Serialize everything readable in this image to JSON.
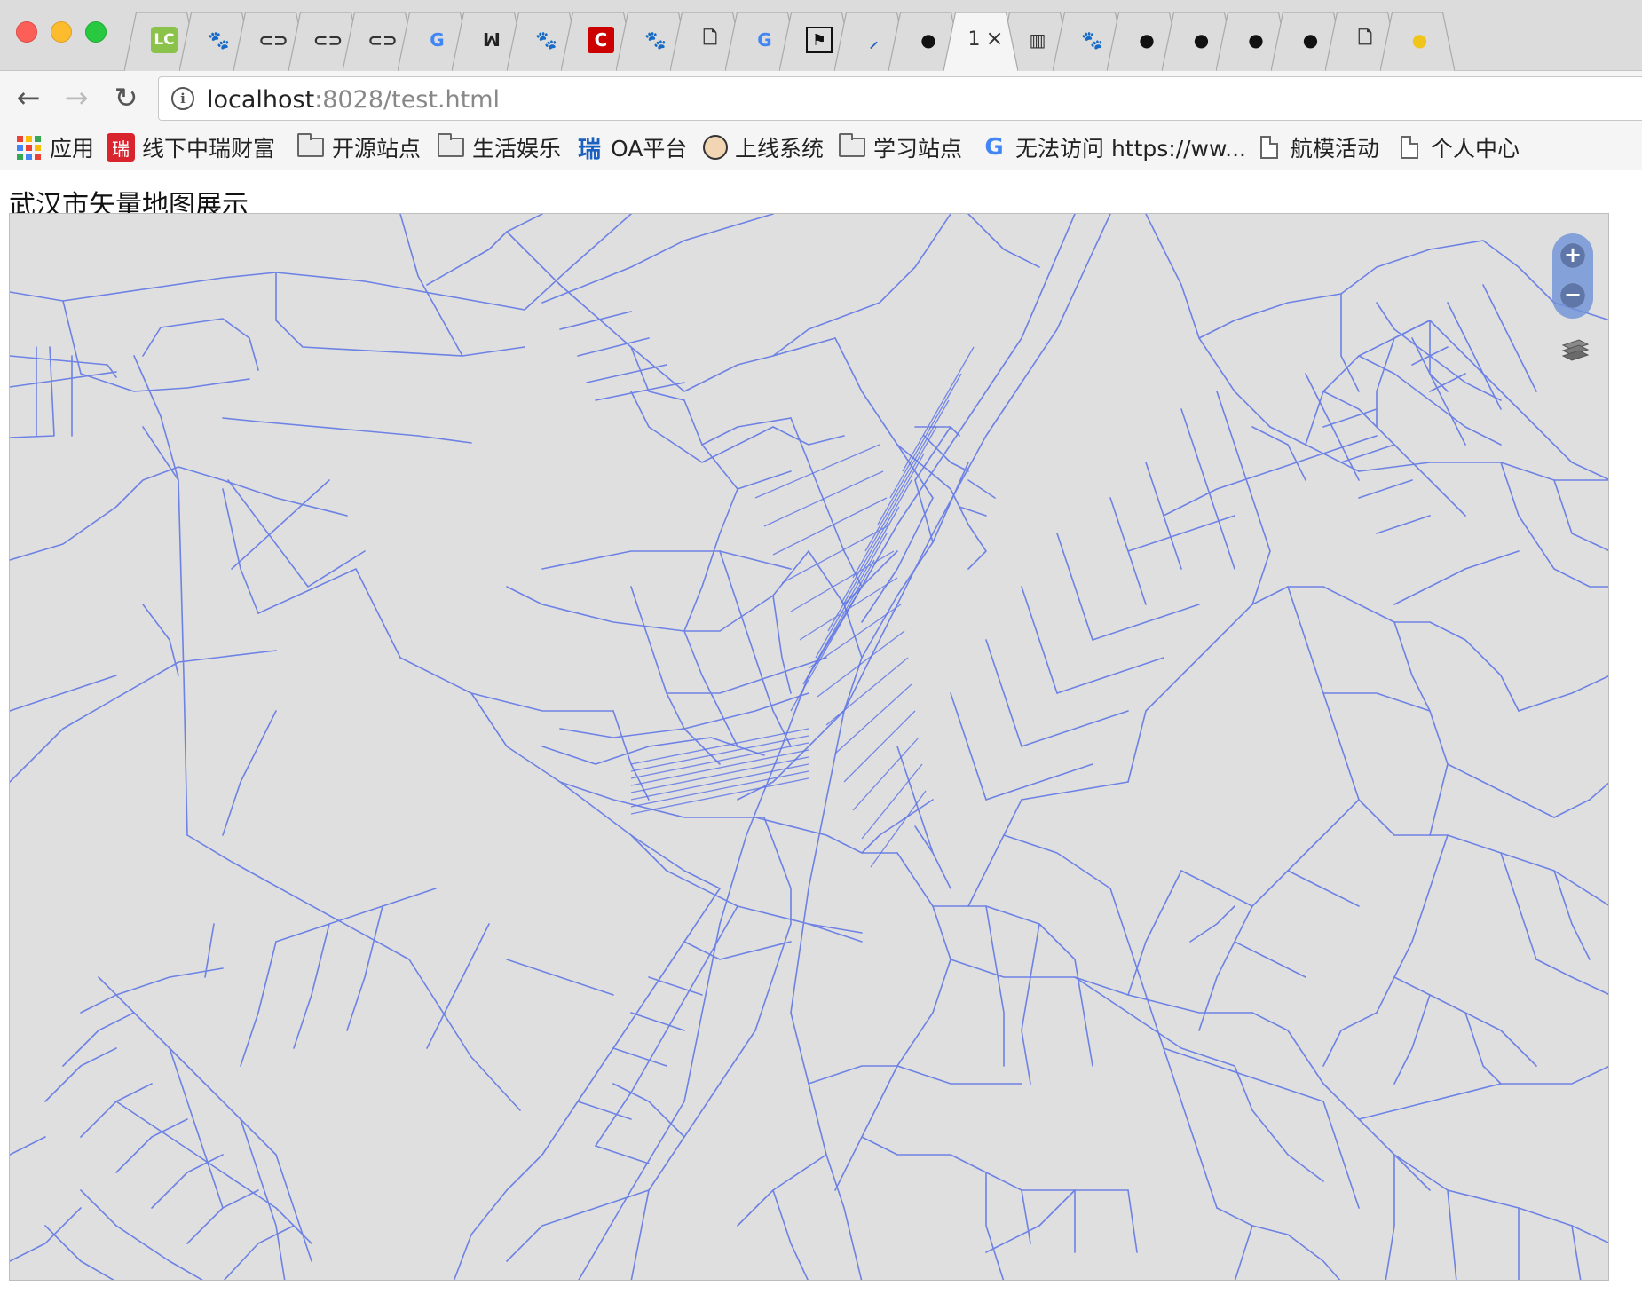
{
  "window": {
    "controls": [
      "close",
      "minimize",
      "zoom"
    ]
  },
  "tabs": [
    {
      "icon": "leetcode-icon",
      "glyph": "LC",
      "color": "#8bc34a"
    },
    {
      "icon": "baidu-paw-icon",
      "glyph": "🐾",
      "color": "#3b4ce0"
    },
    {
      "icon": "link-icon",
      "glyph": "⊂⊃",
      "color": "#333333"
    },
    {
      "icon": "link-icon",
      "glyph": "⊂⊃",
      "color": "#333333"
    },
    {
      "icon": "link-icon",
      "glyph": "⊂⊃",
      "color": "#333333"
    },
    {
      "icon": "google-icon",
      "glyph": "G",
      "color": "#4285f4"
    },
    {
      "icon": "moji-icon",
      "glyph": "ꟽ",
      "color": "#222222"
    },
    {
      "icon": "baidu-paw-icon",
      "glyph": "🐾",
      "color": "#3b4ce0"
    },
    {
      "icon": "csdn-icon",
      "glyph": "C",
      "color": "#cc0000"
    },
    {
      "icon": "baidu-paw-icon",
      "glyph": "🐾",
      "color": "#3b4ce0"
    },
    {
      "icon": "page-icon",
      "glyph": "🗋",
      "color": "#333333"
    },
    {
      "icon": "google-icon",
      "glyph": "G",
      "color": "#4285f4"
    },
    {
      "icon": "flag-icon",
      "glyph": "⚑",
      "color": "#111111"
    },
    {
      "icon": "feather-icon",
      "glyph": "⸝",
      "color": "#2b5fbe"
    },
    {
      "icon": "github-icon",
      "glyph": "●",
      "color": "#111111"
    },
    {
      "icon": "active-tab",
      "glyph": "",
      "color": "#333333",
      "title": "1",
      "close": "×",
      "active": true
    },
    {
      "icon": "book-icon",
      "glyph": "▥",
      "color": "#333333"
    },
    {
      "icon": "baidu-paw-icon",
      "glyph": "🐾",
      "color": "#3b4ce0"
    },
    {
      "icon": "github-icon",
      "glyph": "●",
      "color": "#111111"
    },
    {
      "icon": "github-icon",
      "glyph": "●",
      "color": "#111111"
    },
    {
      "icon": "github-icon",
      "glyph": "●",
      "color": "#111111"
    },
    {
      "icon": "github-icon",
      "glyph": "●",
      "color": "#111111"
    },
    {
      "icon": "page-icon",
      "glyph": "🗋",
      "color": "#333333"
    },
    {
      "icon": "partial-icon",
      "glyph": "●",
      "color": "#f0c419"
    }
  ],
  "toolbar": {
    "back": "←",
    "forward": "→",
    "reload": "↻",
    "info": "i",
    "url_host": "localhost",
    "url_rest": ":8028/test.html"
  },
  "bookmarks": [
    {
      "icon": "apps-grid-icon",
      "label": "应用"
    },
    {
      "icon": "red-square-icon",
      "label": "线下中瑞财富"
    },
    {
      "icon": "folder-icon",
      "label": "开源站点"
    },
    {
      "icon": "folder-icon",
      "label": "生活娱乐"
    },
    {
      "icon": "rui-logo-icon",
      "label": "OA平台"
    },
    {
      "icon": "jenkins-icon",
      "label": "上线系统"
    },
    {
      "icon": "folder-icon",
      "label": "学习站点"
    },
    {
      "icon": "google-icon",
      "label": "无法访问 https://ww..."
    },
    {
      "icon": "page-icon",
      "label": "航模活动"
    },
    {
      "icon": "page-icon",
      "label": "个人中心"
    }
  ],
  "page": {
    "heading": "武汉市矢量地图展示"
  },
  "map": {
    "background": "#dfdfdf",
    "road_color": "#5a72e6",
    "controls": {
      "zoom_in": "+",
      "zoom_out": "−"
    },
    "layer_switcher_icon": "layers-icon"
  },
  "colors": {
    "accent": "#6e91d7",
    "tab_bg": "#dcdcdc",
    "active_tab_bg": "#f5f5f5"
  }
}
